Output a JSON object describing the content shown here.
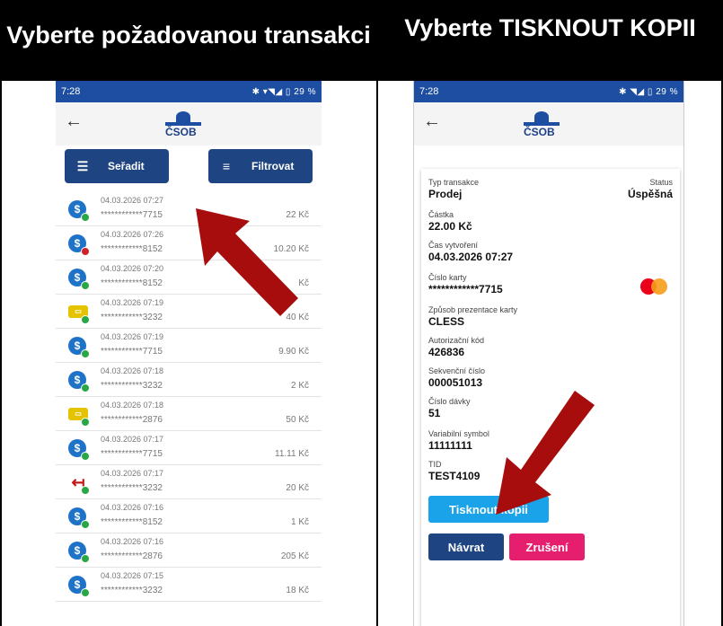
{
  "headings": {
    "left": "Vyberte požadovanou transakci",
    "right": "Vyberte TISKNOUT KOPII"
  },
  "left_screen": {
    "status_time": "7:28",
    "status_icons": "✱ ▾◥◢ ▯ 29 %",
    "logo_text": "ČSOB",
    "sort_label": "Seřadit",
    "filter_label": "Filtrovat",
    "transactions": [
      {
        "date": "04.03.2026 07:27",
        "card": "************7715",
        "amount": "22 Kč",
        "icon": "card-icon",
        "status": "ok"
      },
      {
        "date": "04.03.2026 07:26",
        "card": "************8152",
        "amount": "10.20 Kč",
        "icon": "card-icon",
        "status": "error"
      },
      {
        "date": "04.03.2026 07:20",
        "card": "************8152",
        "amount": "Kč",
        "icon": "card-icon",
        "status": "ok"
      },
      {
        "date": "04.03.2026 07:19",
        "card": "************3232",
        "amount": "40 Kč",
        "icon": "cash-icon",
        "status": "ok"
      },
      {
        "date": "04.03.2026 07:19",
        "card": "************7715",
        "amount": "9.90 Kč",
        "icon": "card-icon",
        "status": "ok"
      },
      {
        "date": "04.03.2026 07:18",
        "card": "************3232",
        "amount": "2 Kč",
        "icon": "card-icon",
        "status": "ok"
      },
      {
        "date": "04.03.2026 07:18",
        "card": "************2876",
        "amount": "50 Kč",
        "icon": "cash-icon",
        "status": "ok"
      },
      {
        "date": "04.03.2026 07:17",
        "card": "************7715",
        "amount": "11.11 Kč",
        "icon": "card-icon",
        "status": "ok"
      },
      {
        "date": "04.03.2026 07:17",
        "card": "************3232",
        "amount": "20 Kč",
        "icon": "refund-icon",
        "status": "ok"
      },
      {
        "date": "04.03.2026 07:16",
        "card": "************8152",
        "amount": "1 Kč",
        "icon": "card-icon",
        "status": "ok"
      },
      {
        "date": "04.03.2026 07:16",
        "card": "************2876",
        "amount": "205 Kč",
        "icon": "card-icon",
        "status": "ok"
      },
      {
        "date": "04.03.2026 07:15",
        "card": "************3232",
        "amount": "18 Kč",
        "icon": "card-icon",
        "status": "ok"
      }
    ]
  },
  "right_screen": {
    "status_time": "7:28",
    "status_icons": "✱ ◥◢ ▯ 29 %",
    "logo_text": "ČSOB",
    "fields": {
      "type_label": "Typ transakce",
      "type_value": "Prodej",
      "status_label": "Status",
      "status_value": "Úspěšná",
      "amount_label": "Částka",
      "amount_value": "22.00 Kč",
      "created_label": "Čas vytvoření",
      "created_value": "04.03.2026 07:27",
      "card_label": "Číslo karty",
      "card_value": "************7715",
      "presentation_label": "Způsob prezentace karty",
      "presentation_value": "CLESS",
      "auth_label": "Autorizační kód",
      "auth_value": "426836",
      "seq_label": "Sekvenční číslo",
      "seq_value": "000051013",
      "batch_label": "Číslo dávky",
      "batch_value": "51",
      "vs_label": "Variabilní symbol",
      "vs_value": "11111111",
      "tid_label": "TID",
      "tid_value": "TEST4109"
    },
    "print_label": "Tisknout kopii",
    "back_label": "Návrat",
    "cancel_label": "Zrušení"
  },
  "colors": {
    "arrow": "#a80d0d",
    "brand": "#1e4ea1",
    "print": "#1aa3e8",
    "cancel": "#e61e6e"
  }
}
